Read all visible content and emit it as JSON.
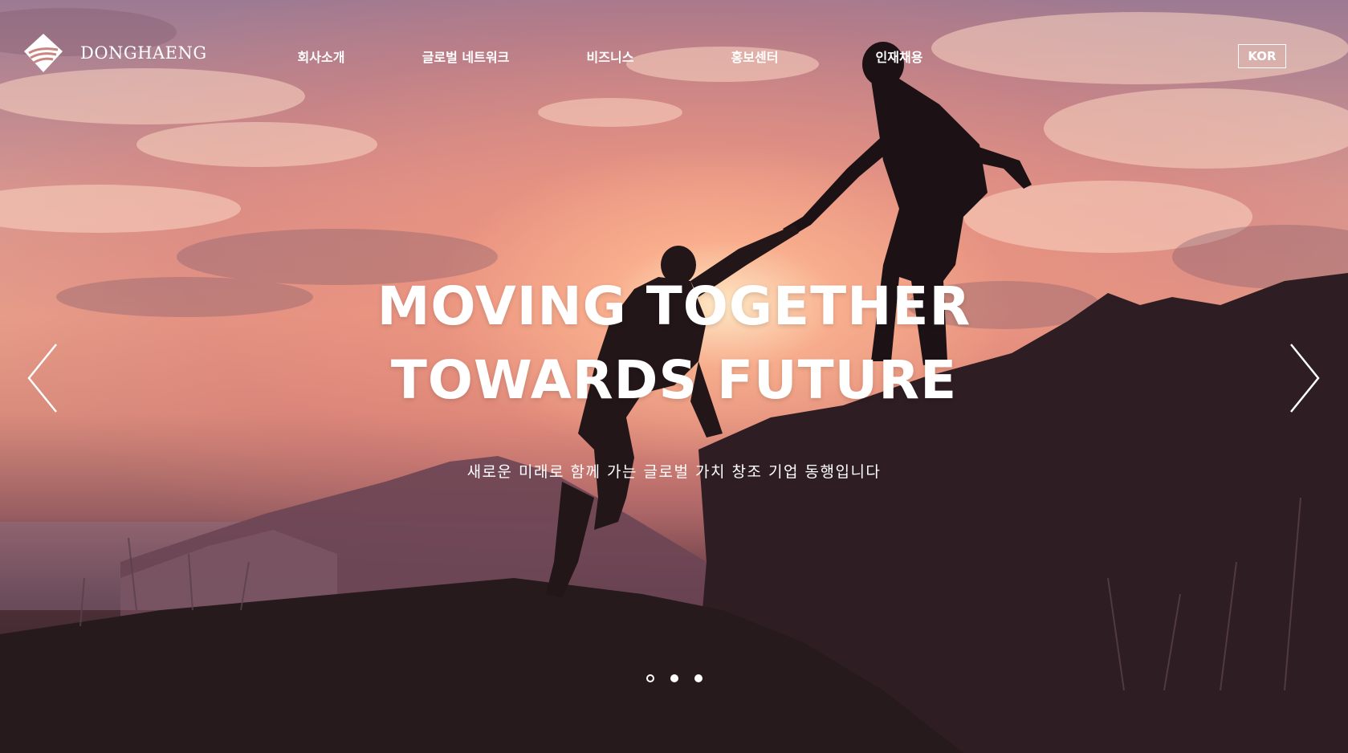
{
  "brand": {
    "name": "DONGHAENG",
    "logo_icon": "donghaeng-logo-icon"
  },
  "nav": {
    "items": [
      {
        "label": "회사소개"
      },
      {
        "label": "글로벌 네트워크"
      },
      {
        "label": "비즈니스"
      },
      {
        "label": "홍보센터"
      },
      {
        "label": "인재채용"
      }
    ],
    "language": "KOR"
  },
  "hero": {
    "headline_line1": "MOVING TOGETHER",
    "headline_line2": "TOWARDS FUTURE",
    "subcopy": "새로운 미래로 함께 가는 글로벌 가치 창조 기업 동행입니다",
    "prev_icon": "chevron-left-icon",
    "next_icon": "chevron-right-icon"
  },
  "slider": {
    "total_slides": 3,
    "active_slide": 1
  },
  "colors": {
    "text": "#ffffff",
    "sky_top": "#9c7a93",
    "sky_mid": "#e79d89",
    "ground": "#2b1b20"
  }
}
